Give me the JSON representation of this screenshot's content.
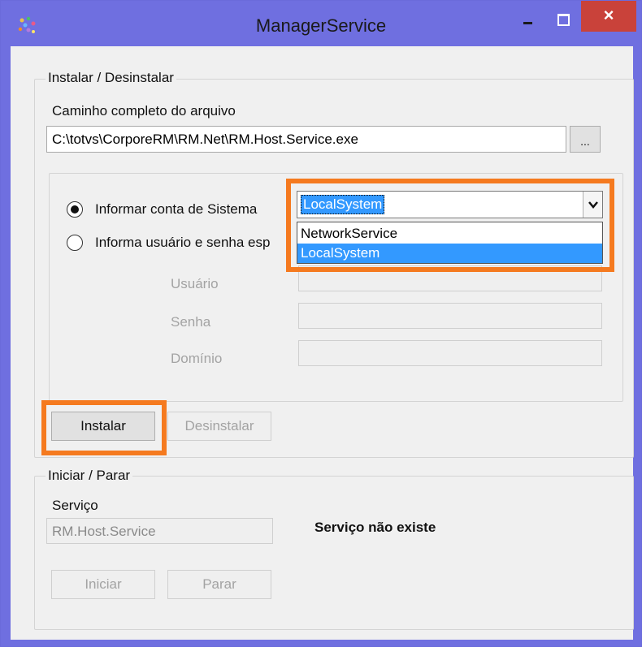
{
  "window": {
    "title": "ManagerService",
    "controls": {
      "minimize": "minimize",
      "maximize": "maximize",
      "close": "×"
    }
  },
  "install_group": {
    "legend": "Instalar / Desinstalar",
    "path_label": "Caminho completo do arquivo",
    "path_value": "C:\\totvs\\CorporeRM\\RM.Net\\RM.Host.Service.exe",
    "browse_label": "...",
    "account": {
      "option_system_label": "Informar conta de Sistema",
      "option_system_selected": true,
      "option_user_label": "Informa usuário e senha esp",
      "option_user_selected": false,
      "combo_value": "LocalSystem",
      "combo_options": [
        "NetworkService",
        "LocalSystem"
      ],
      "combo_selected_index": 1,
      "user_label": "Usuário",
      "password_label": "Senha",
      "domain_label": "Domínio",
      "user_value": "",
      "password_value": "",
      "domain_value": ""
    },
    "install_button": "Instalar",
    "uninstall_button": "Desinstalar"
  },
  "start_group": {
    "legend": "Iniciar / Parar",
    "service_label": "Serviço",
    "service_value": "RM.Host.Service",
    "status_text": "Serviço não existe",
    "start_button": "Iniciar",
    "stop_button": "Parar"
  },
  "colors": {
    "titlebar": "#6f6fe0",
    "close_button": "#c9423a",
    "highlight": "#f57a1f",
    "selection": "#3399ff"
  }
}
